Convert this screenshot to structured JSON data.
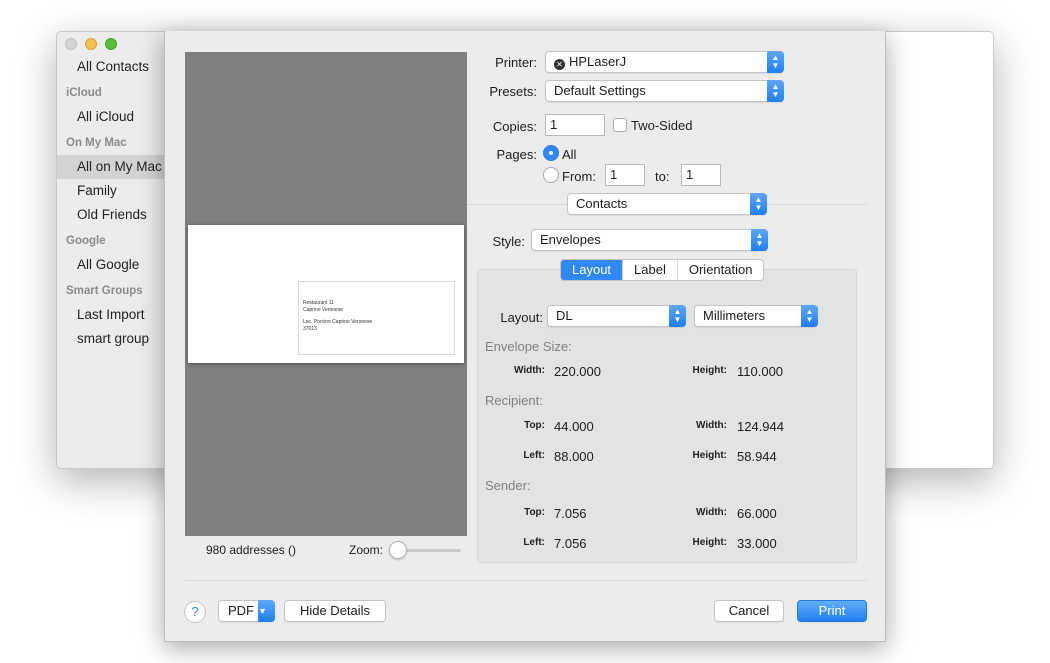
{
  "contacts_sidebar": {
    "items": [
      {
        "label": "All Contacts",
        "type": "item"
      },
      {
        "label": "iCloud",
        "type": "header"
      },
      {
        "label": "All iCloud",
        "type": "item"
      },
      {
        "label": "On My Mac",
        "type": "header"
      },
      {
        "label": "All on My Mac",
        "type": "item",
        "selected": true
      },
      {
        "label": "Family",
        "type": "item"
      },
      {
        "label": "Old Friends",
        "type": "item"
      },
      {
        "label": "Google",
        "type": "header"
      },
      {
        "label": "All Google",
        "type": "item"
      },
      {
        "label": "Smart Groups",
        "type": "header"
      },
      {
        "label": "Last Import",
        "type": "item"
      },
      {
        "label": "smart group",
        "type": "item"
      }
    ]
  },
  "preview": {
    "address_lines": [
      "Restaurant 11",
      "Caprino Veronese",
      "",
      "Loc. Porcino Caprino Veronese",
      "37013"
    ],
    "addresses_count": "980 addresses ()",
    "zoom_label": "Zoom:"
  },
  "print": {
    "printer_label": "Printer:",
    "printer_value": "HPLaserJ",
    "presets_label": "Presets:",
    "presets_value": "Default Settings",
    "copies_label": "Copies:",
    "copies_value": "1",
    "two_sided_label": "Two-Sided",
    "pages_label": "Pages:",
    "pages_all_label": "All",
    "pages_from_label": "From:",
    "pages_from_value": "1",
    "pages_to_label": "to:",
    "pages_to_value": "1",
    "app_menu_value": "Contacts"
  },
  "contacts_options": {
    "style_label": "Style:",
    "style_value": "Envelopes",
    "tabs": [
      "Layout",
      "Label",
      "Orientation"
    ],
    "layout_label": "Layout:",
    "layout_value": "DL",
    "units_value": "Millimeters",
    "envelope_size_title": "Envelope Size:",
    "envelope_width_label": "Width:",
    "envelope_width_value": "220.000",
    "envelope_height_label": "Height:",
    "envelope_height_value": "110.000",
    "recipient_title": "Recipient:",
    "recipient_top_label": "Top:",
    "recipient_top_value": "44.000",
    "recipient_width_label": "Width:",
    "recipient_width_value": "124.944",
    "recipient_left_label": "Left:",
    "recipient_left_value": "88.000",
    "recipient_height_label": "Height:",
    "recipient_height_value": "58.944",
    "sender_title": "Sender:",
    "sender_top_label": "Top:",
    "sender_top_value": "7.056",
    "sender_width_label": "Width:",
    "sender_width_value": "66.000",
    "sender_left_label": "Left:",
    "sender_left_value": "7.056",
    "sender_height_label": "Height:",
    "sender_height_value": "33.000"
  },
  "footer": {
    "help_label": "?",
    "pdf_label": "PDF",
    "hide_details_label": "Hide Details",
    "cancel_label": "Cancel",
    "print_label": "Print"
  },
  "icons": {
    "printer_status": "x-circle-icon",
    "popup_arrows": "up-down-chevrons-icon"
  },
  "colors": {
    "accent": "#2f88f5",
    "preview_bg": "#808080",
    "sheet_bg": "#ececec"
  }
}
